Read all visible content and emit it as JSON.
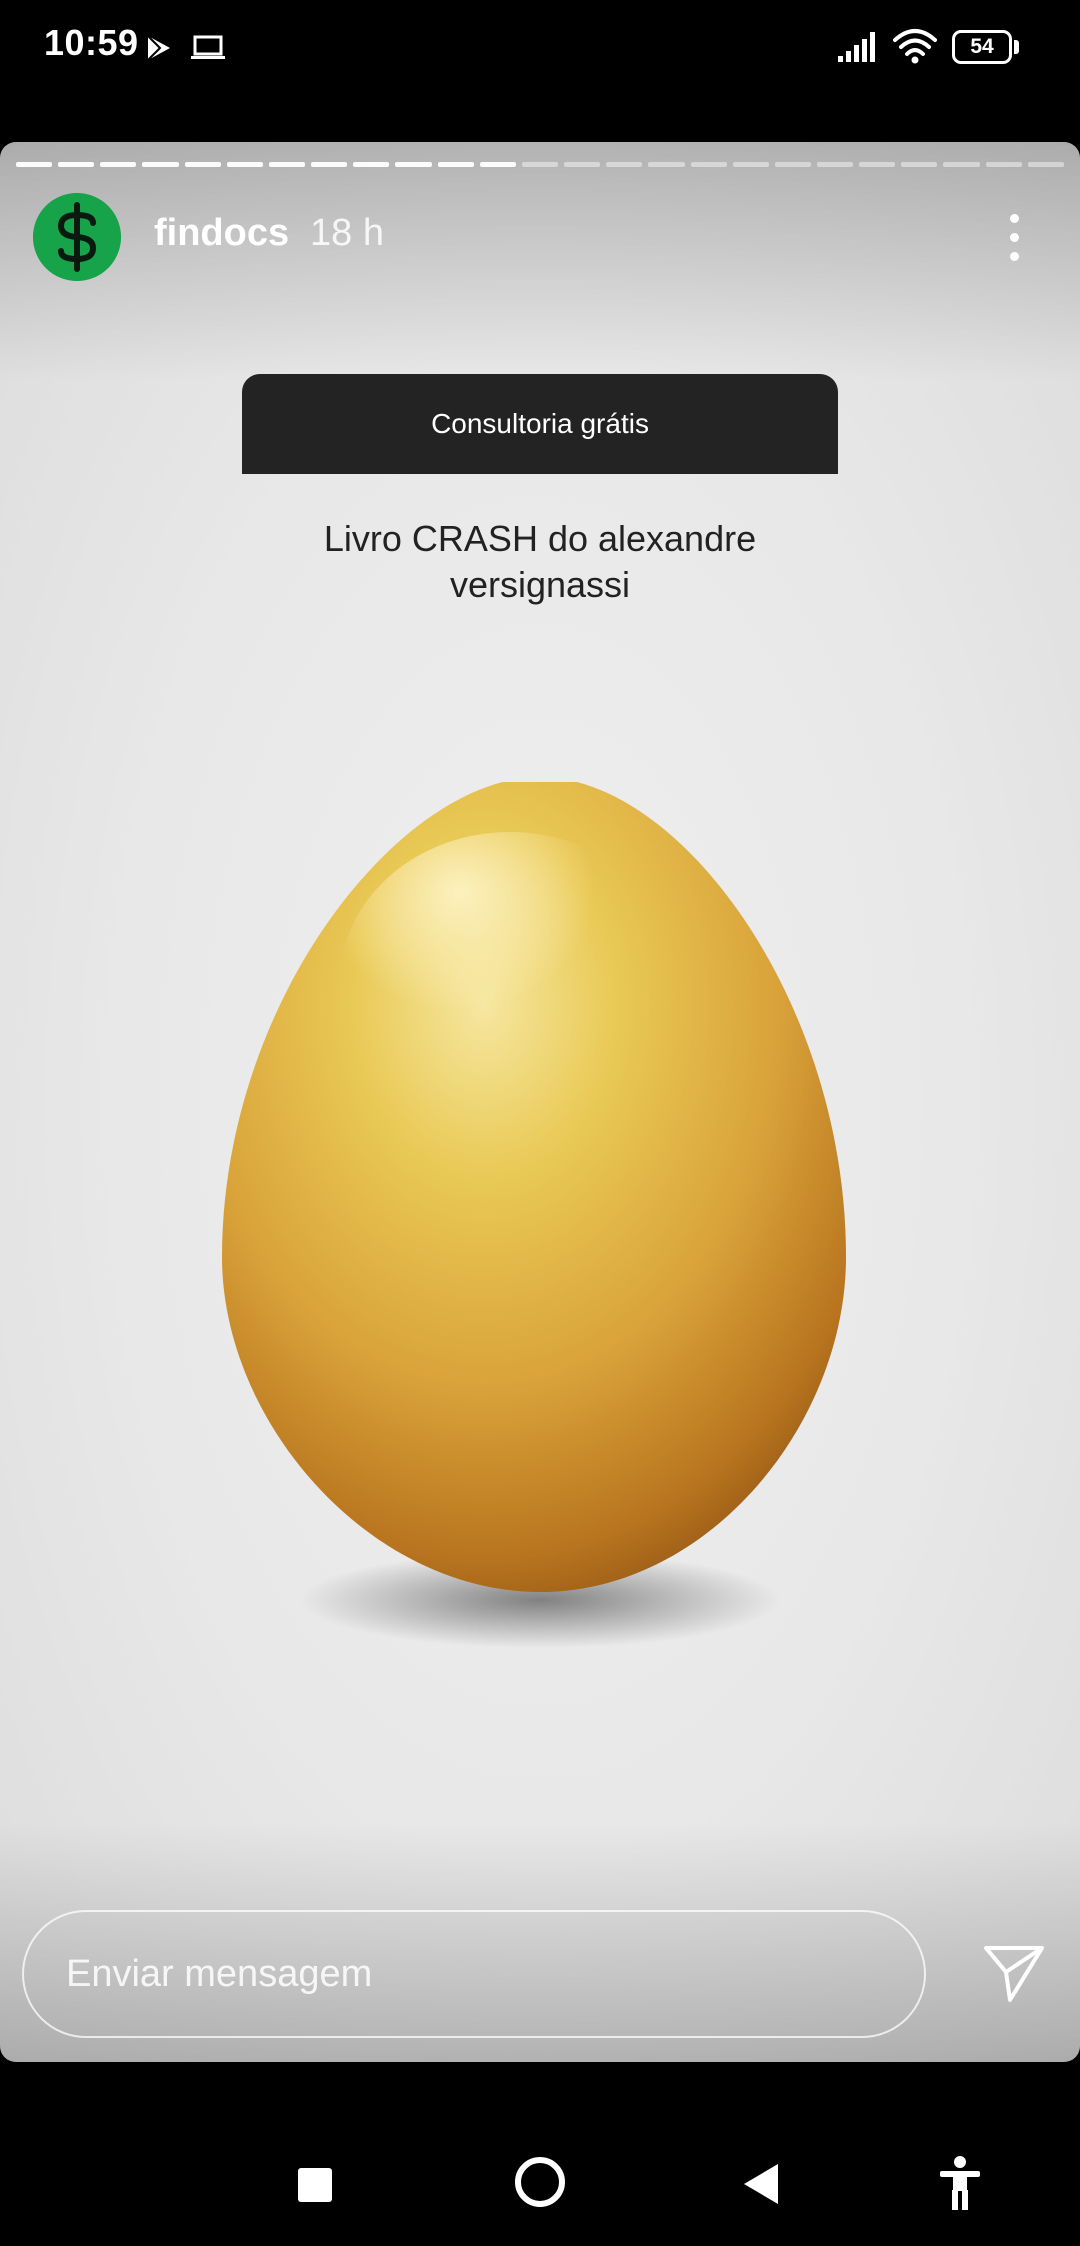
{
  "status_bar": {
    "time": "10:59",
    "battery": "54",
    "icons": [
      "play-store-icon",
      "laptop-icon",
      "signal-icon",
      "wifi-icon",
      "battery-icon"
    ]
  },
  "story": {
    "progress": {
      "current_story": 1,
      "visible_segments": 25
    },
    "username": "findocs",
    "time_ago": "18 h",
    "link_sticker": "Consultoria grátis",
    "caption": "Livro CRASH do alexandre versignassi",
    "image": "golden-egg",
    "reply_placeholder": "Enviar mensagem"
  },
  "colors": {
    "avatar_bg": "#16a34a",
    "sticker_bg": "#232323",
    "story_bg": "#e8e8e8"
  },
  "nav_bar": {
    "icons": [
      "recents-icon",
      "home-icon",
      "back-icon",
      "accessibility-icon"
    ]
  }
}
